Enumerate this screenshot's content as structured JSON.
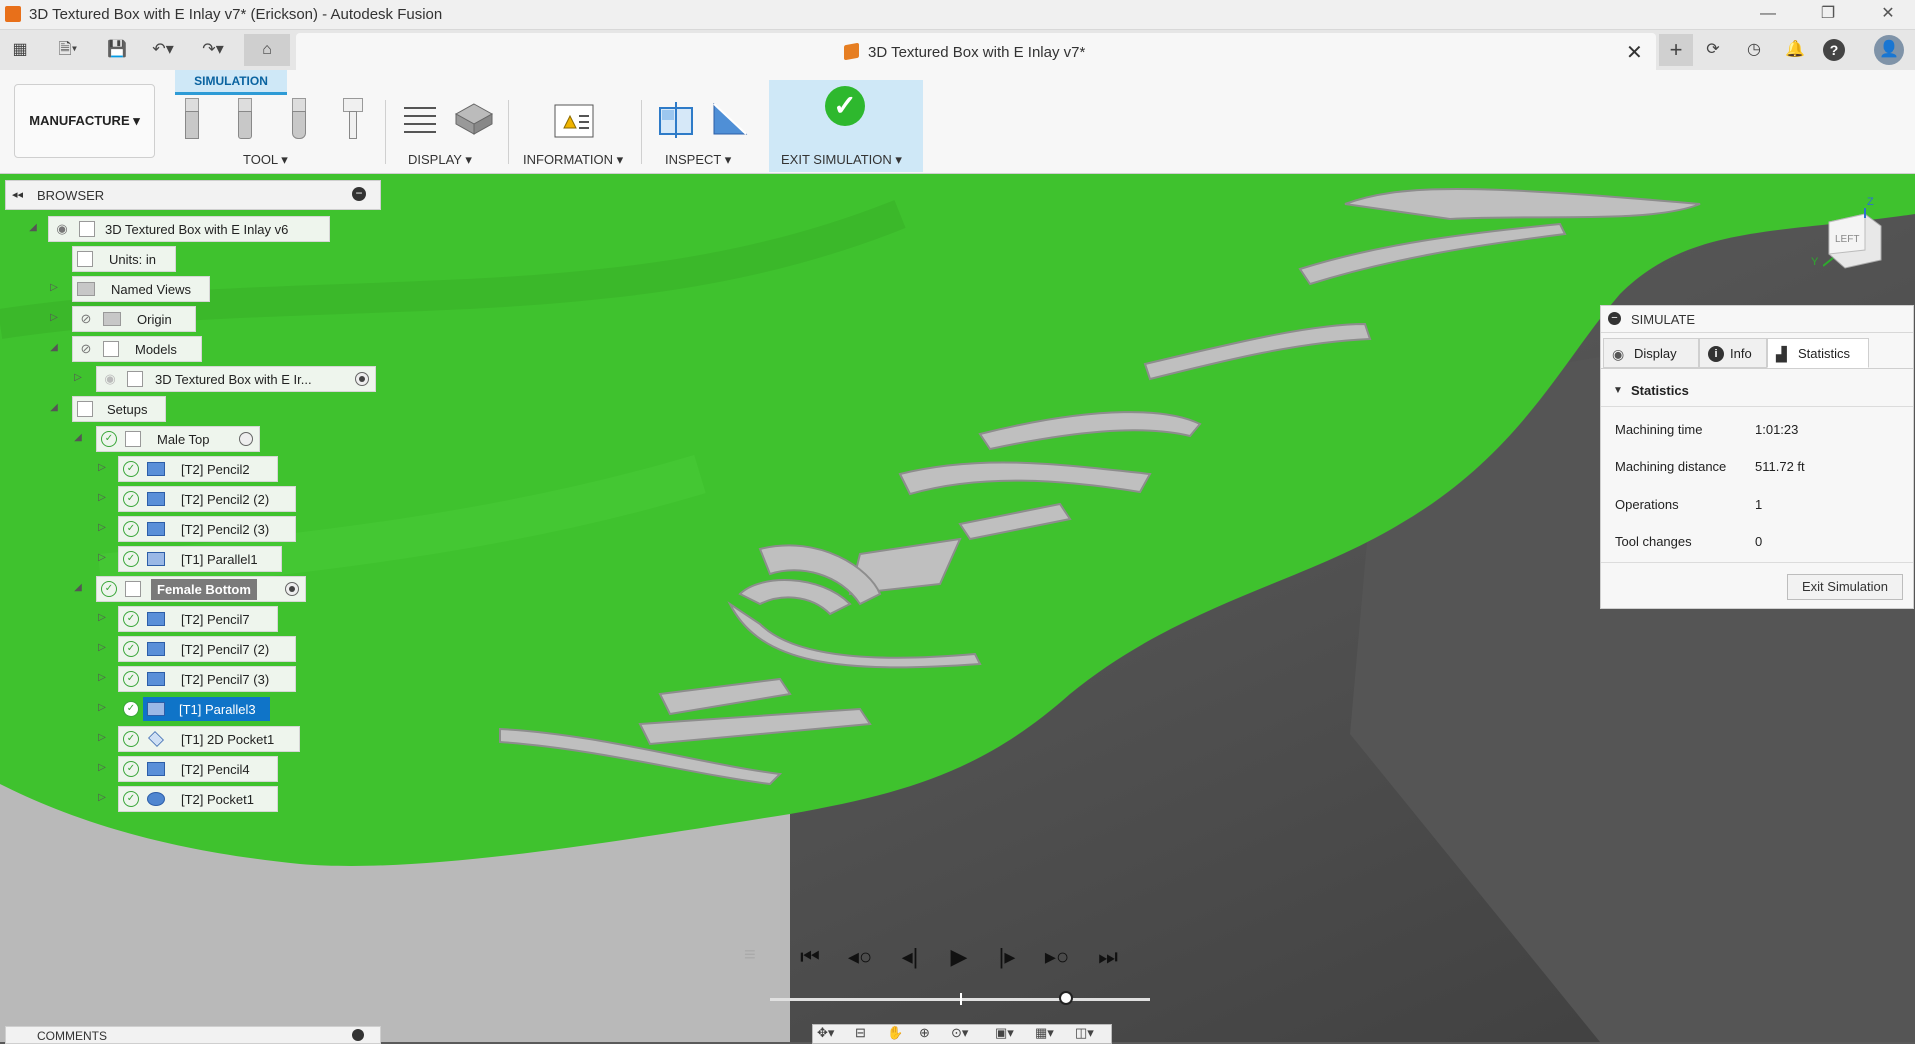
{
  "window": {
    "title": "3D Textured Box with E Inlay v7* (Erickson) - Autodesk Fusion",
    "minimize": "—",
    "maximize": "❐",
    "close": "✕"
  },
  "document_tab": {
    "title": "3D Textured Box with E Inlay v7*",
    "close": "✕"
  },
  "toolbar_icons": {
    "grid": "▦",
    "file": "🗎▾",
    "save": "💾",
    "undo": "↶▾",
    "redo": "↷▾",
    "home": "⌂",
    "add": "+",
    "extensions": "⟳",
    "jobs": "◷",
    "notifications": "🔔",
    "help": "?",
    "profile": "👤"
  },
  "ribbon": {
    "workspace": "MANUFACTURE ▾",
    "active_tab": "SIMULATION",
    "groups": {
      "tool": "TOOL ▾",
      "display": "DISPLAY ▾",
      "information": "INFORMATION ▾",
      "inspect": "INSPECT ▾",
      "exit": "EXIT SIMULATION ▾"
    }
  },
  "browser": {
    "header": "BROWSER",
    "collapse_glyph": "◂◂",
    "minus_glyph": "−",
    "nodes": [
      {
        "label": "3D Textured Box with E Inlay v6"
      },
      {
        "label": "Units: in"
      },
      {
        "label": "Named Views"
      },
      {
        "label": "Origin"
      },
      {
        "label": "Models"
      },
      {
        "label": "3D Textured Box with E Ir..."
      },
      {
        "label": "Setups"
      },
      {
        "label": "Male Top"
      },
      {
        "label": "[T2] Pencil2"
      },
      {
        "label": "[T2] Pencil2 (2)"
      },
      {
        "label": "[T2] Pencil2 (3)"
      },
      {
        "label": "[T1] Parallel1"
      },
      {
        "label": "Female Bottom"
      },
      {
        "label": "[T2] Pencil7"
      },
      {
        "label": "[T2] Pencil7 (2)"
      },
      {
        "label": "[T2] Pencil7 (3)"
      },
      {
        "label": "[T1] Parallel3"
      },
      {
        "label": "[T1] 2D Pocket1"
      },
      {
        "label": "[T2] Pencil4"
      },
      {
        "label": "[T2] Pocket1"
      }
    ]
  },
  "simulate": {
    "header": "SIMULATE",
    "tabs": [
      "Display",
      "Info",
      "Statistics"
    ],
    "section": "Statistics",
    "stats": [
      {
        "label": "Machining time",
        "value": "1:01:23"
      },
      {
        "label": "Machining distance",
        "value": "511.72 ft"
      },
      {
        "label": "Operations",
        "value": "1"
      },
      {
        "label": "Tool changes",
        "value": "0"
      }
    ],
    "exit_button": "Exit Simulation"
  },
  "viewcube": {
    "face": "LEFT",
    "axis_z": "Z",
    "axis_y": "Y"
  },
  "comments": {
    "header": "COMMENTS"
  },
  "playback": {
    "icons": [
      "⏮",
      "◂○",
      "◂|",
      "▶",
      "|▸",
      "▸○",
      "⏭"
    ],
    "progress": 0.78
  },
  "colors": {
    "stock_green": "#3fc22e",
    "selection_blue": "#0f74c8",
    "exit_bg": "#cfe8f7",
    "check_green": "#2eb82e"
  }
}
